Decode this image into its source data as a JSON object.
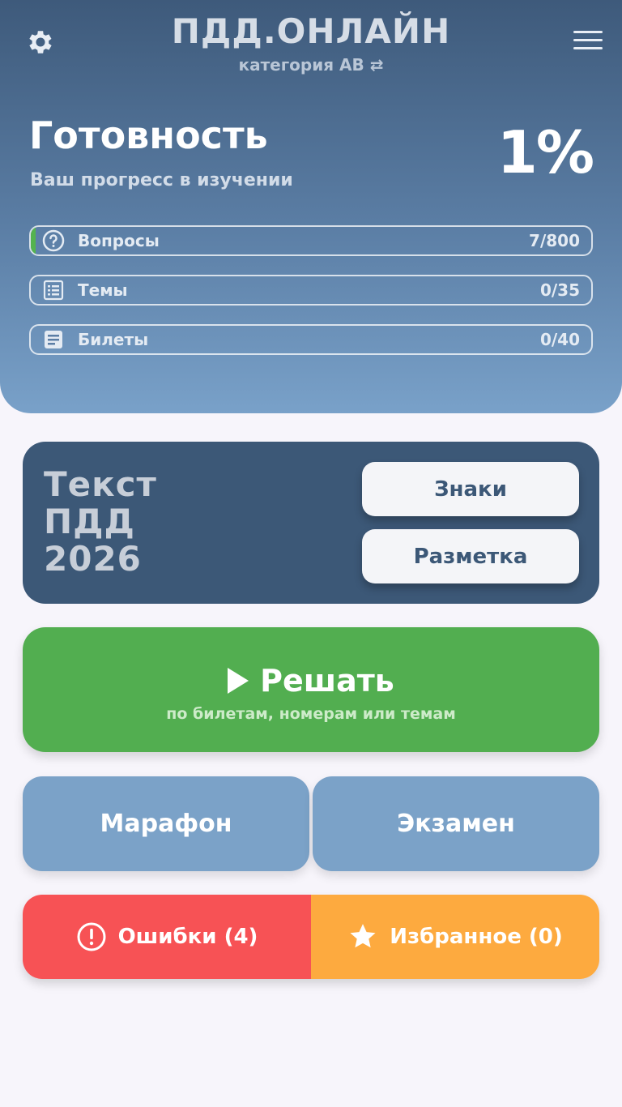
{
  "header": {
    "app_title": "ПДД.ОНЛАЙН",
    "category": "категория АВ ⇄",
    "readiness_title": "Готовность",
    "readiness_subtitle": "Ваш прогресс в изучении",
    "readiness_percent": "1%",
    "progress": [
      {
        "label": "Вопросы",
        "count": "7/800",
        "icon": "question-icon",
        "fraction": 0.00875
      },
      {
        "label": "Темы",
        "count": "0/35",
        "icon": "list-icon",
        "fraction": 0
      },
      {
        "label": "Билеты",
        "count": "0/40",
        "icon": "ticket-icon",
        "fraction": 0
      }
    ]
  },
  "text_card": {
    "line1": "Текст",
    "line2": "ПДД",
    "line3": "2026",
    "signs_label": "Знаки",
    "markings_label": "Разметка"
  },
  "solve": {
    "label": "Решать",
    "subtitle": "по билетам, номерам или темам"
  },
  "modes": {
    "marathon_label": "Марафон",
    "exam_label": "Экзамен"
  },
  "bottom": {
    "errors_label": "Ошибки (4)",
    "favorites_label": "Избранное (0)"
  },
  "colors": {
    "header_top": "#3e5a7b",
    "header_bottom": "#79a1c9",
    "card": "#3c5877",
    "green": "#52ae50",
    "blue": "#7ba2c8",
    "red": "#f75255",
    "orange": "#fdaa3f",
    "progress_fill": "#54b34f"
  }
}
